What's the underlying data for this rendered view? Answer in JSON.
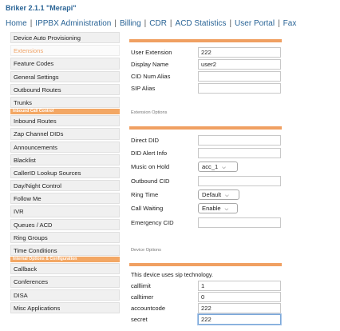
{
  "app_title": "Briker 2.1.1 \"Merapi\"",
  "topnav": [
    "Home",
    "IPPBX Administration",
    "Billing",
    "CDR",
    "ACD Statistics",
    "User Portal",
    "Fax"
  ],
  "sidebar": [
    {
      "label": "Device Auto Provisioning"
    },
    {
      "label": "Extensions",
      "active": true
    },
    {
      "label": "Feature Codes"
    },
    {
      "label": "General Settings"
    },
    {
      "label": "Outbound Routes"
    },
    {
      "label": "Trunks"
    },
    {
      "label": "Inbound Call Control",
      "header": true
    },
    {
      "label": "Inbound Routes"
    },
    {
      "label": "Zap Channel DIDs"
    },
    {
      "label": "Announcements"
    },
    {
      "label": "Blacklist"
    },
    {
      "label": "CallerID Lookup Sources"
    },
    {
      "label": "Day/Night Control"
    },
    {
      "label": "Follow Me"
    },
    {
      "label": "IVR"
    },
    {
      "label": "Queues / ACD"
    },
    {
      "label": "Ring Groups"
    },
    {
      "label": "Time Conditions"
    },
    {
      "label": "Internal Options & Configuration",
      "header": true
    },
    {
      "label": "Callback"
    },
    {
      "label": "Conferences"
    },
    {
      "label": "DISA"
    },
    {
      "label": "Misc Applications"
    }
  ],
  "form": {
    "user_extension": {
      "label": "User Extension",
      "value": "222"
    },
    "display_name": {
      "label": "Display Name",
      "value": "user2"
    },
    "cid_num_alias": {
      "label": "CID Num Alias",
      "value": ""
    },
    "sip_alias": {
      "label": "SIP Alias",
      "value": ""
    },
    "extension_options_title": "Extension Options",
    "direct_did": {
      "label": "Direct DID",
      "value": ""
    },
    "did_alert_info": {
      "label": "DID Alert Info",
      "value": ""
    },
    "music_on_hold": {
      "label": "Music on Hold",
      "value": "acc_1"
    },
    "outbound_cid": {
      "label": "Outbound CID",
      "value": ""
    },
    "ring_time": {
      "label": "Ring Time",
      "value": "Default"
    },
    "call_waiting": {
      "label": "Call Waiting",
      "value": "Enable"
    },
    "emergency_cid": {
      "label": "Emergency CID",
      "value": ""
    },
    "device_options_title": "Device Options",
    "device_note": "This device uses sip technology.",
    "calllimit": {
      "label": "calllimit",
      "value": "1"
    },
    "calltimer": {
      "label": "calltimer",
      "value": "0"
    },
    "accountcode": {
      "label": "accountcode",
      "value": "222"
    },
    "secret": {
      "label": "secret",
      "value": "222"
    }
  }
}
